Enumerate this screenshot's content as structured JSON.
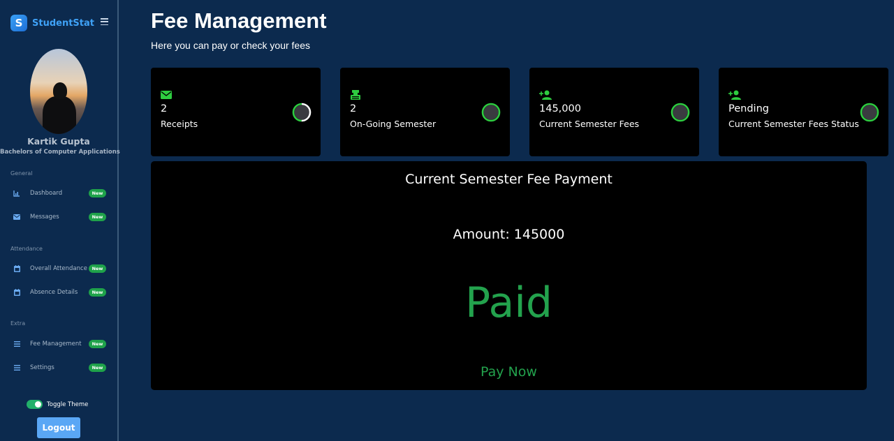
{
  "app": {
    "name": "StudentStat",
    "logo_letter": "S"
  },
  "user": {
    "name": "Kartik Gupta",
    "course": "Bachelors of Computer Applications"
  },
  "sidebar": {
    "sections": [
      {
        "label": "General",
        "items": [
          {
            "label": "Dashboard",
            "icon": "bar-chart-icon",
            "badge": "New"
          },
          {
            "label": "Messages",
            "icon": "envelope-icon",
            "badge": "New"
          }
        ]
      },
      {
        "label": "Attendance",
        "items": [
          {
            "label": "Overall Attendance",
            "icon": "calendar-icon",
            "badge": "New"
          },
          {
            "label": "Absence Details",
            "icon": "calendar-icon",
            "badge": "New"
          }
        ]
      },
      {
        "label": "Extra",
        "items": [
          {
            "label": "Fee Management",
            "icon": "list-icon",
            "badge": "New"
          },
          {
            "label": "Settings",
            "icon": "list-icon",
            "badge": "New"
          }
        ]
      }
    ],
    "toggle_label": "Toggle Theme",
    "toggle_on": true,
    "logout_label": "Logout"
  },
  "page": {
    "title": "Fee Management",
    "subtitle": "Here you can pay or check your fees"
  },
  "cards": [
    {
      "value": "2",
      "label": "Receipts",
      "icon": "envelope-icon",
      "ring_progress": 0.5
    },
    {
      "value": "2",
      "label": "On-Going Semester",
      "icon": "cash-register-icon",
      "ring_progress": 1
    },
    {
      "value": "145,000",
      "label": "Current Semester Fees",
      "icon": "user-plus-icon",
      "ring_progress": 1
    },
    {
      "value": "Pending",
      "label": "Current Semester Fees Status",
      "icon": "user-plus-icon",
      "ring_progress": 1
    }
  ],
  "payment": {
    "title": "Current Semester Fee Payment",
    "amount_text": "Amount: 145000",
    "status": "Paid",
    "pay_label": "Pay Now"
  },
  "colors": {
    "background": "#0c2a4e",
    "card": "#000000",
    "accent_green": "#23a24d",
    "badge_green": "#1fa24a",
    "brand_blue": "#3fa2f7",
    "ring_green": "#2ecc40"
  }
}
